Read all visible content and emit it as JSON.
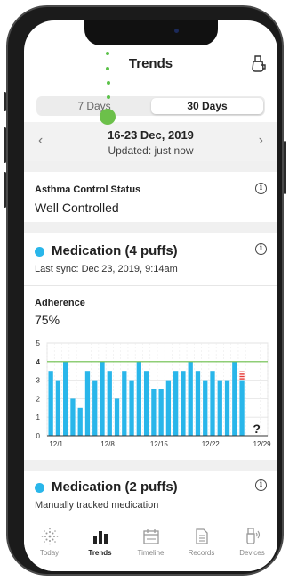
{
  "header": {
    "title": "Trends",
    "inhaler_icon": "inhaler-icon"
  },
  "segment": {
    "option_7": "7 Days",
    "option_30": "30 Days",
    "selected": "30 Days"
  },
  "date_bar": {
    "range": "16-23 Dec, 2019",
    "updated": "Updated: just now",
    "prev_icon": "chevron-left-icon",
    "next_icon": "chevron-right-icon"
  },
  "asthma": {
    "label": "Asthma Control Status",
    "value": "Well Controlled"
  },
  "medication1": {
    "title": "Medication (4 puffs)",
    "sync": "Last sync: Dec 23, 2019, 9:14am"
  },
  "adherence": {
    "label": "Adherence",
    "value": "75%"
  },
  "medication2": {
    "title": "Medication (2 puffs)",
    "subtitle": "Manually tracked medication"
  },
  "colors": {
    "accent_blue": "#29b6ea",
    "target_green": "#6cc04a",
    "overuse_red": "#e53935"
  },
  "chart_data": {
    "type": "bar",
    "ylim": [
      0,
      5
    ],
    "y_ticks": [
      "0",
      "1",
      "2",
      "3",
      "4",
      "5"
    ],
    "x_tick_labels": [
      "12/1",
      "12/8",
      "12/15",
      "12/22",
      "12/29"
    ],
    "target_line": 4,
    "days": 30,
    "values": [
      3.5,
      3,
      4,
      2,
      1.5,
      3.5,
      3,
      4,
      3.5,
      2,
      3.5,
      3,
      4,
      3.5,
      2.5,
      2.5,
      3,
      3.5,
      3.5,
      4,
      3.5,
      3,
      3.5,
      3,
      3,
      4,
      3
    ],
    "overuse_days": [
      26
    ],
    "unknown_marker": "?"
  },
  "tabs": [
    {
      "label": "Today",
      "icon": "sun-dots-icon"
    },
    {
      "label": "Trends",
      "icon": "bar-chart-icon"
    },
    {
      "label": "Timeline",
      "icon": "calendar-icon"
    },
    {
      "label": "Records",
      "icon": "document-icon"
    },
    {
      "label": "Devices",
      "icon": "inhaler-device-icon"
    }
  ]
}
